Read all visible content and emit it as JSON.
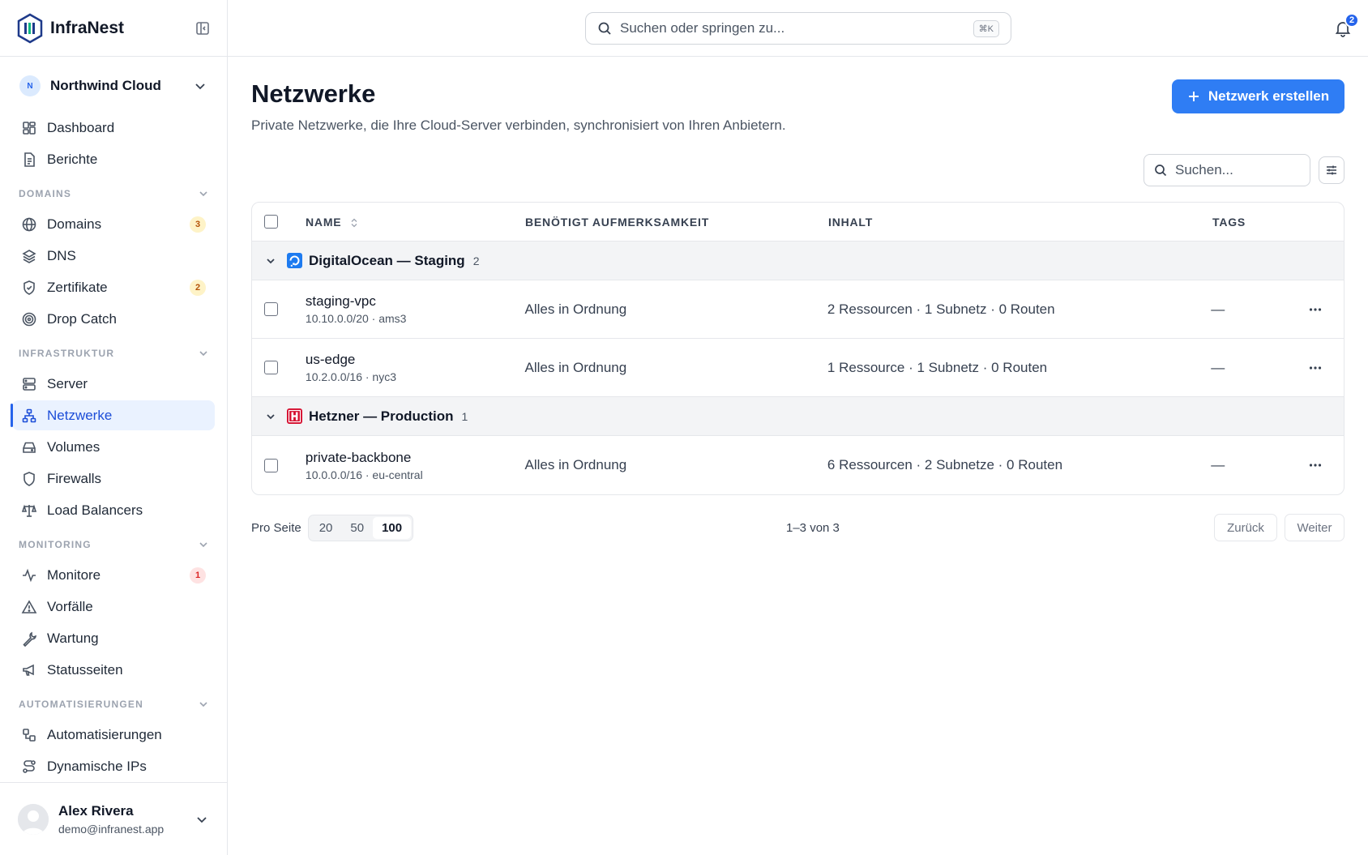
{
  "app": {
    "name": "InfraNest"
  },
  "org": {
    "initial": "N",
    "name": "Northwind Cloud"
  },
  "nav_top": [
    {
      "label": "Dashboard",
      "icon": "dashboard-icon"
    },
    {
      "label": "Berichte",
      "icon": "document-icon"
    }
  ],
  "sections": {
    "domains": {
      "title": "DOMAINS",
      "items": [
        {
          "label": "Domains",
          "badge": "3"
        },
        {
          "label": "DNS"
        },
        {
          "label": "Zertifikate",
          "badge": "2"
        },
        {
          "label": "Drop Catch"
        }
      ]
    },
    "infra": {
      "title": "INFRASTRUKTUR",
      "items": [
        {
          "label": "Server"
        },
        {
          "label": "Netzwerke",
          "active": true
        },
        {
          "label": "Volumes"
        },
        {
          "label": "Firewalls"
        },
        {
          "label": "Load Balancers"
        }
      ]
    },
    "monitoring": {
      "title": "MONITORING",
      "items": [
        {
          "label": "Monitore",
          "badge": "1"
        },
        {
          "label": "Vorfälle"
        },
        {
          "label": "Wartung"
        },
        {
          "label": "Statusseiten"
        }
      ]
    },
    "automation": {
      "title": "AUTOMATISIERUNGEN",
      "items": [
        {
          "label": "Automatisierungen"
        },
        {
          "label": "Dynamische IPs"
        }
      ]
    }
  },
  "user": {
    "name": "Alex Rivera",
    "email": "demo@infranest.app"
  },
  "topbar": {
    "search_placeholder": "Suchen oder springen zu...",
    "shortcut": "⌘K",
    "notifications": "2"
  },
  "page": {
    "title": "Netzwerke",
    "subtitle": "Private Netzwerke, die Ihre Cloud-Server verbinden, synchronisiert von Ihren Anbietern.",
    "create_button": "Netzwerk erstellen",
    "table_search_placeholder": "Suchen..."
  },
  "table": {
    "headers": {
      "name": "NAME",
      "attention": "BENÖTIGT AUFMERKSAMKEIT",
      "content": "INHALT",
      "tags": "TAGS"
    },
    "groups": [
      {
        "name": "DigitalOcean — Staging",
        "count": "2",
        "rows": [
          {
            "name": "staging-vpc",
            "sub": "10.10.0.0/20 · ams3",
            "attention": "Alles in Ordnung",
            "content": "2 Ressourcen · 1 Subnetz · 0 Routen",
            "tags": "—"
          },
          {
            "name": "us-edge",
            "sub": "10.2.0.0/16 · nyc3",
            "attention": "Alles in Ordnung",
            "content": "1 Ressource · 1 Subnetz · 0 Routen",
            "tags": "—"
          }
        ]
      },
      {
        "name": "Hetzner — Production",
        "count": "1",
        "rows": [
          {
            "name": "private-backbone",
            "sub": "10.0.0.0/16 · eu-central",
            "attention": "Alles in Ordnung",
            "content": "6 Ressourcen · 2 Subnetze · 0 Routen",
            "tags": "—"
          }
        ]
      }
    ]
  },
  "pager": {
    "per_page_label": "Pro Seite",
    "options": [
      "20",
      "50",
      "100"
    ],
    "selected": "100",
    "range": "1–3 von 3",
    "prev": "Zurück",
    "next": "Weiter"
  },
  "colors": {
    "accent": "#2f7df4",
    "digitalocean": "#1e7bf0",
    "hetzner": "#d50c2d"
  }
}
